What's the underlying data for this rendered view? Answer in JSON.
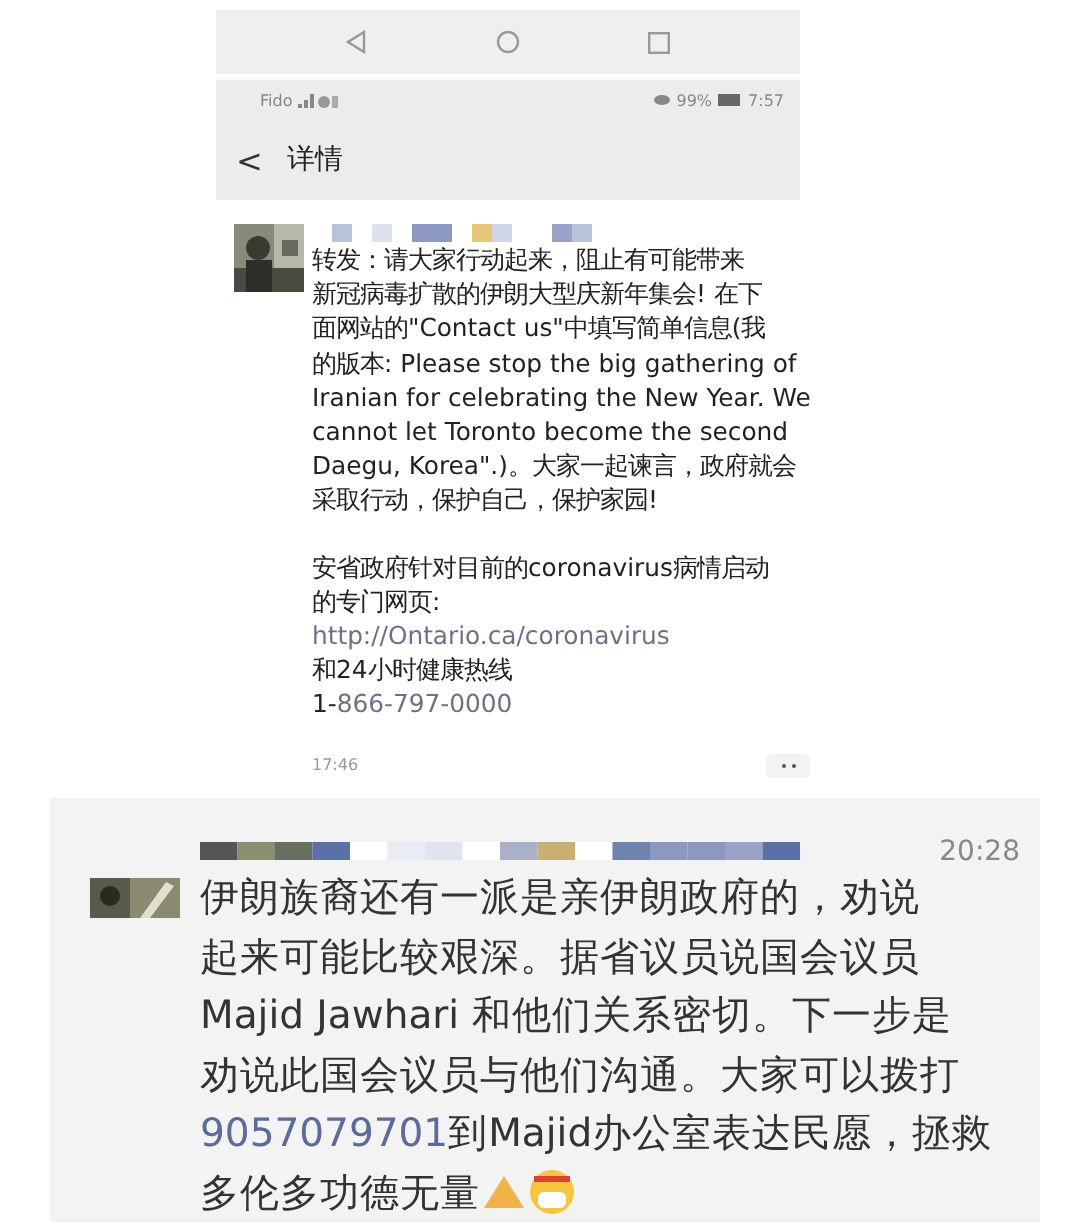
{
  "status_bar": {
    "carrier": "Fido",
    "battery": "99%",
    "time": "7:57"
  },
  "header": {
    "back": "<",
    "title": "详情"
  },
  "post": {
    "paragraphs": [
      [
        [
          {
            "text": "转发：请大家行动起来，阻止有可能带来",
            "link": false
          }
        ],
        [
          {
            "text": "新冠病毒扩散的伊朗大型庆新年集会! 在下",
            "link": false
          }
        ],
        [
          {
            "text": "面网站的\"Contact us\"中填写简单信息(我",
            "link": false
          }
        ],
        [
          {
            "text": "的版本: Please stop the big gathering of",
            "link": false
          }
        ],
        [
          {
            "text": "Iranian for celebrating the New Year. We",
            "link": false
          }
        ],
        [
          {
            "text": "cannot let Toronto become the second",
            "link": false
          }
        ],
        [
          {
            "text": "Daegu, Korea\".)。大家一起谏言，政府就会",
            "link": false
          }
        ],
        [
          {
            "text": "采取行动，保护自己，保护家园!",
            "link": false
          }
        ]
      ],
      [
        [
          {
            "text": "安省政府针对目前的coronavirus病情启动",
            "link": false
          }
        ],
        [
          {
            "text": "的专门网页:",
            "link": false
          }
        ],
        [
          {
            "text": "http://Ontario.ca/coronavirus",
            "link": true
          }
        ],
        [
          {
            "text": "和24小时健康热线",
            "link": false
          }
        ],
        [
          {
            "text": "1-",
            "link": false
          },
          {
            "text": "866-797-0000",
            "link": true
          }
        ]
      ]
    ],
    "time": "17:46"
  },
  "chat": {
    "time": "20:28",
    "lines": [
      [
        {
          "text": "伊朗族裔还有一派是亲伊朗政府的，劝说",
          "link": false
        }
      ],
      [
        {
          "text": "起来可能比较艰深。据省议员说国会议员",
          "link": false
        }
      ],
      [
        {
          "text": "Majid Jawhari 和他们关系密切。下一步是",
          "link": false
        }
      ],
      [
        {
          "text": "劝说此国会议员与他们沟通。大家可以拨打",
          "link": false
        }
      ],
      [
        {
          "text": "9057079701",
          "link": true
        },
        {
          "text": "到Majid办公室表达民愿，拯救",
          "link": false
        }
      ],
      [
        {
          "text": "多伦多功德无量",
          "link": false
        }
      ]
    ]
  }
}
